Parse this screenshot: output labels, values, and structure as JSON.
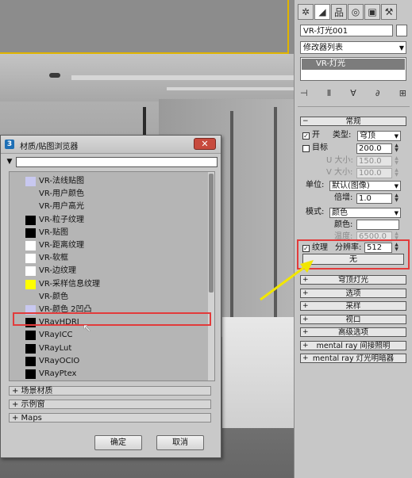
{
  "panel": {
    "tabs": [
      {
        "icon": "create-icon",
        "glyph": "✲"
      },
      {
        "icon": "modify-icon",
        "glyph": "◢"
      },
      {
        "icon": "hierarchy-icon",
        "glyph": "品"
      },
      {
        "icon": "motion-icon",
        "glyph": "◎"
      },
      {
        "icon": "display-icon",
        "glyph": "▣"
      },
      {
        "icon": "utilities-icon",
        "glyph": "⚒"
      }
    ],
    "object_name": "VR-灯光001",
    "modifier_list": "修改器列表",
    "stack_item": "VR-灯光",
    "stack_controls": [
      "⊣",
      "Ⅱ",
      "∀",
      "∂",
      "⊞"
    ],
    "general": {
      "header": "常规",
      "on_label": "开",
      "type_label": "类型:",
      "type_value": "穹顶",
      "target_label": "目标",
      "target_value": "200.0",
      "u_size_label": "U 大小:",
      "u_size_value": "150.0",
      "v_size_label": "V 大小:",
      "v_size_value": "100.0",
      "units_label": "单位:",
      "units_value": "默认(图像)",
      "multiplier_label": "倍增:",
      "multiplier_value": "1.0",
      "mode_label": "模式:",
      "mode_value": "颜色",
      "color_label": "颜色:",
      "temp_label": "温度:",
      "temp_value": "6500.0",
      "texture_label": "纹理",
      "resolution_label": "分辨率:",
      "resolution_value": "512",
      "none_button": "无"
    },
    "rollouts": [
      "穹顶灯光",
      "选项",
      "采样",
      "视口",
      "高级选项",
      "mental ray 间接照明",
      "mental ray 灯光明暗器"
    ]
  },
  "dialog": {
    "title": "材质/贴图浏览器",
    "close": "✕",
    "filter_value": "",
    "items": [
      {
        "label": "VR-法线贴图",
        "color": "#c8c8f0"
      },
      {
        "label": "VR-用户颜色",
        "color": ""
      },
      {
        "label": "VR-用户高光",
        "color": ""
      },
      {
        "label": "VR-粒子纹理",
        "color": "#000000"
      },
      {
        "label": "VR-贴图",
        "color": "#000000"
      },
      {
        "label": "VR-距离纹理",
        "color": "#ffffff"
      },
      {
        "label": "VR-软框",
        "color": "#ffffff"
      },
      {
        "label": "VR-边纹理",
        "color": "#ffffff"
      },
      {
        "label": "VR-采样信息纹理",
        "color": "#ffff00"
      },
      {
        "label": "VR-颜色",
        "color": ""
      },
      {
        "label": "VR-颜色 2凹凸",
        "color": "#c8c8f0"
      },
      {
        "label": "VRayHDRI",
        "color": "#000000"
      },
      {
        "label": "VRayICC",
        "color": "#000000"
      },
      {
        "label": "VRayLut",
        "color": "#000000"
      },
      {
        "label": "VRayOCIO",
        "color": "#000000"
      },
      {
        "label": "VRayPtex",
        "color": "#000000"
      }
    ],
    "groups": [
      "+ 场景材质",
      "+ 示例窗",
      "+ Maps"
    ],
    "ok_button": "确定",
    "cancel_button": "取消"
  },
  "colors": {
    "highlight": "#e23b3b",
    "arrow": "#f2e600"
  }
}
